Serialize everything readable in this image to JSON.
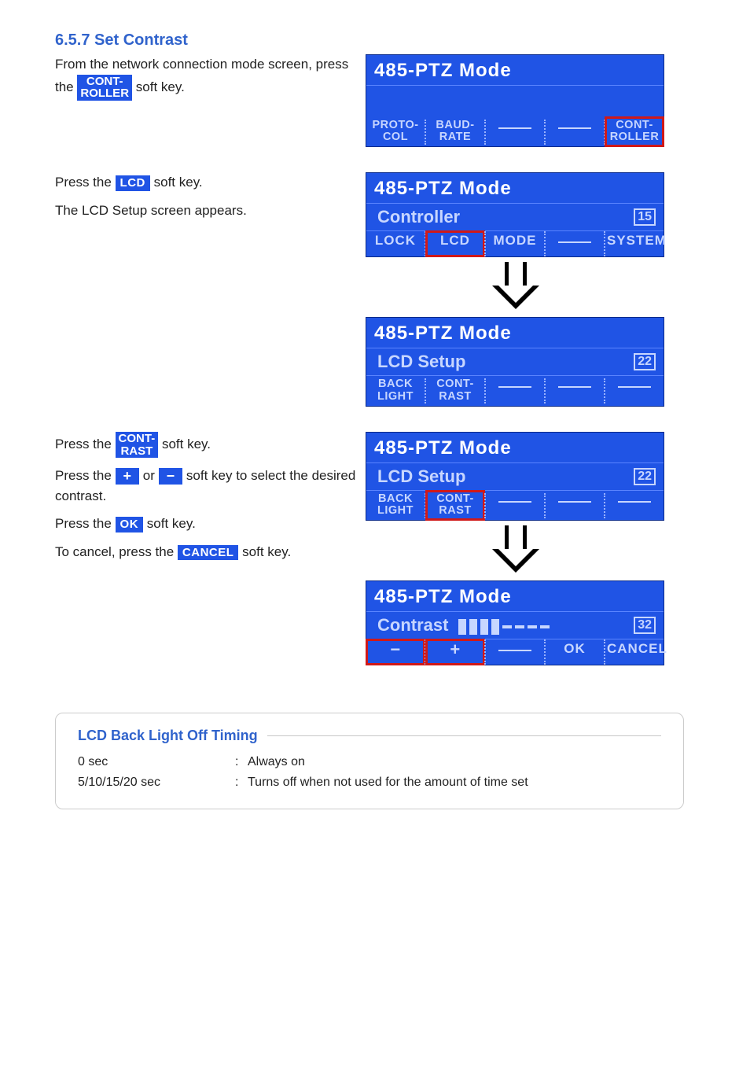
{
  "heading": "6.5.7 Set Contrast",
  "step1": {
    "intro_prefix": "From the network connection mode screen, press the ",
    "chip": "CONT-\nROLLER",
    "intro_suffix": " soft key."
  },
  "step2": {
    "line_a_prefix": "Press the ",
    "chip": "LCD",
    "line_a_suffix": " soft key.",
    "line_b": "The LCD Setup screen appears."
  },
  "step3": {
    "l1_prefix": "Press the ",
    "chip1": "CONT-\nRAST",
    "l1_suffix": " soft key.",
    "l2a": "Press the ",
    "plus": "+",
    "l2b": " or ",
    "minus": "−",
    "l2c": " soft key to select the desired contrast.",
    "l3a": "Press the ",
    "ok": "OK",
    "l3b": " soft key.",
    "l4a": "To cancel, press the ",
    "cancel": "CANCEL",
    "l4b": " soft key."
  },
  "panel_title": "485-PTZ Mode",
  "panel1": {
    "keys": [
      "PROTO-\nCOL",
      "BAUD-\nRATE",
      "",
      "",
      "CONT-\nROLLER"
    ]
  },
  "panel2": {
    "sub": "Controller",
    "idx": "15",
    "keys": [
      "LOCK",
      "LCD",
      "MODE",
      "",
      "SYSTEM"
    ]
  },
  "panel3": {
    "sub": "LCD Setup",
    "idx": "22",
    "keys": [
      "BACK\nLIGHT",
      "CONT-\nRAST",
      "",
      "",
      ""
    ]
  },
  "panel4": {
    "sub_label": "Contrast",
    "idx": "32",
    "meter": {
      "on": 4,
      "total": 8
    },
    "keys": [
      "−",
      "+",
      "",
      "OK",
      "CANCEL"
    ]
  },
  "timing": {
    "title": "LCD Back Light Off Timing",
    "rows": [
      {
        "k": "0 sec",
        "v": "Always on"
      },
      {
        "k": "5/10/15/20 sec",
        "v": "Turns off when not used for the amount of time set"
      }
    ]
  },
  "footer": {
    "center": "",
    "right": ""
  }
}
